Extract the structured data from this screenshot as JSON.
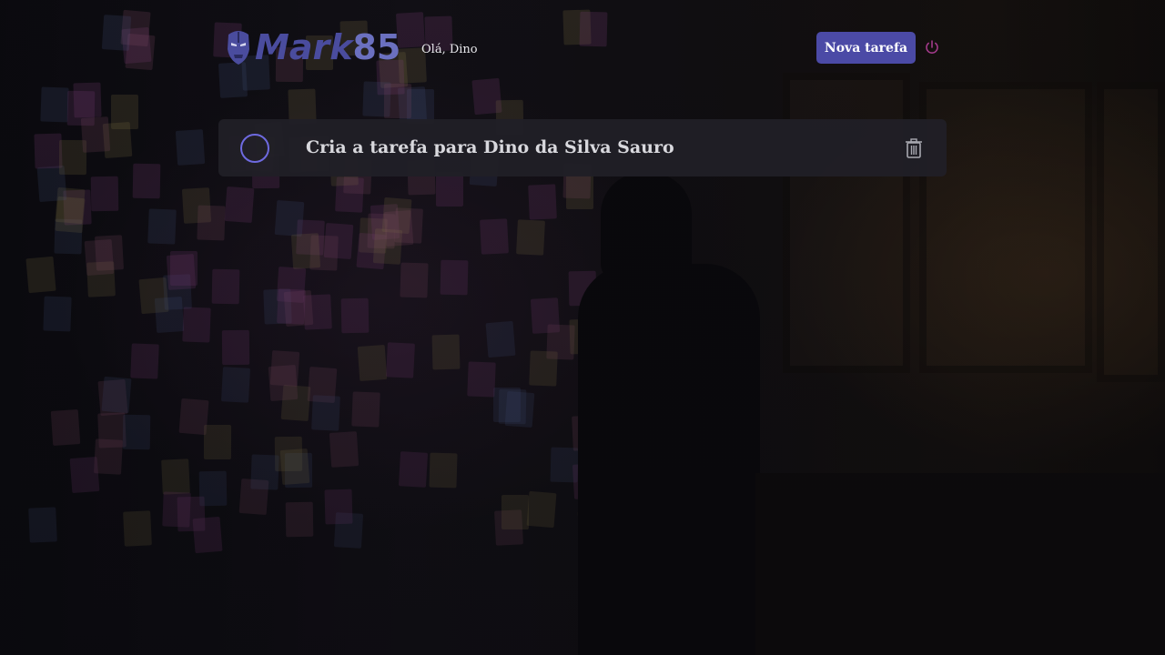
{
  "app": {
    "brand_word": "Mark",
    "brand_number": "85",
    "greeting": "Olá, Dino"
  },
  "header": {
    "new_task_label": "Nova tarefa",
    "logout_icon": "power-icon",
    "logo_icon": "iron-mask-icon"
  },
  "tasks": [
    {
      "title": "Cria a tarefa para Dino da Silva Sauro",
      "done": false,
      "delete_icon": "trash-icon"
    }
  ],
  "colors": {
    "accent": "#4b4aa6",
    "checkbox": "#6e6ae0",
    "logout": "#a23a8a",
    "card": "#201f26"
  }
}
